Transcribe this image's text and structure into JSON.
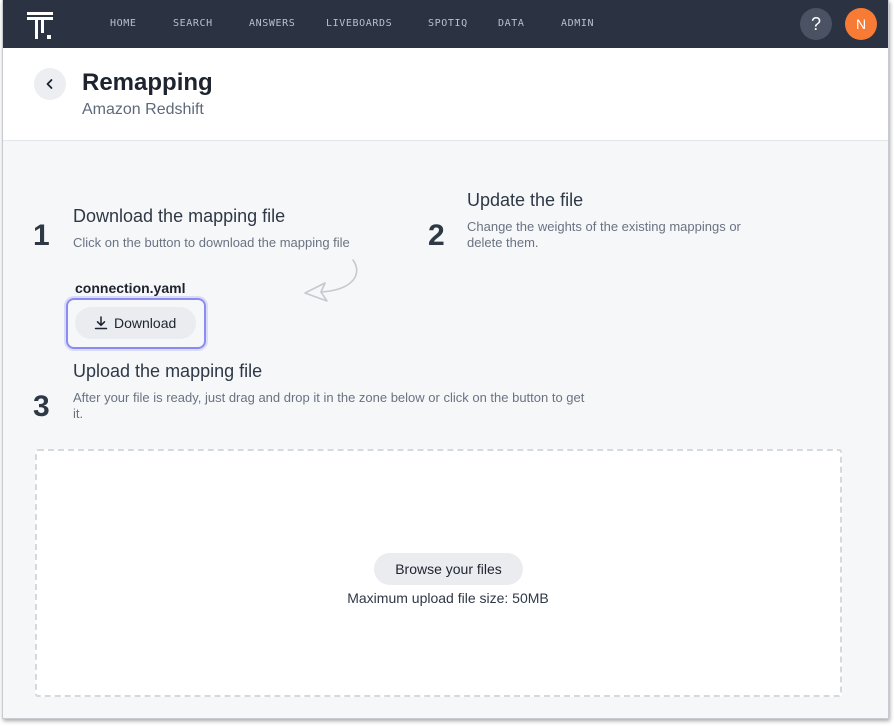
{
  "nav": {
    "items": [
      "HOME",
      "SEARCH",
      "ANSWERS",
      "LIVEBOARDS",
      "SPOTIQ",
      "DATA",
      "ADMIN"
    ],
    "help_label": "?",
    "avatar_initial": "N",
    "avatar_color": "#f77a35",
    "bar_color": "#2b3342"
  },
  "header": {
    "title": "Remapping",
    "subtitle": "Amazon Redshift"
  },
  "steps": [
    {
      "number": "1",
      "title": "Download the mapping file",
      "description": "Click on the button to download the mapping file"
    },
    {
      "number": "2",
      "title": "Update the file",
      "description": "Change the weights of the existing mappings or delete them."
    },
    {
      "number": "3",
      "title": "Upload the mapping file",
      "description": "After your file is ready, just drag and drop it in the zone below or click on the button to get it."
    }
  ],
  "download": {
    "file_name": "connection.yaml",
    "button_label": "Download",
    "highlight_color": "#8b8cf2"
  },
  "upload": {
    "browse_label": "Browse your files",
    "max_size_text": "Maximum upload file size: 50MB"
  },
  "icons": {
    "logo": "thoughtspot-logo-icon",
    "back": "chevron-left-icon",
    "download": "download-icon",
    "arrow": "curved-arrow-icon"
  }
}
